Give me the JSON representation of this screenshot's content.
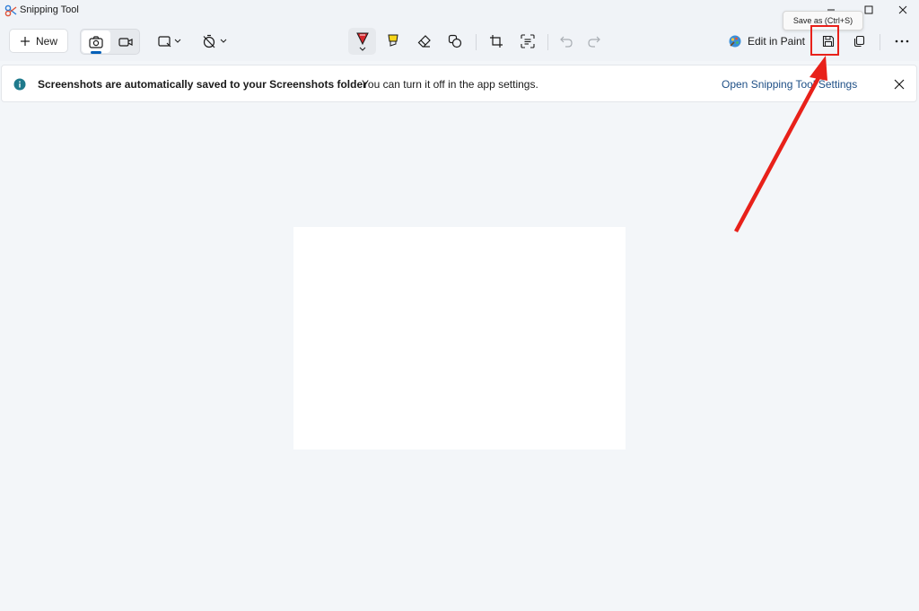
{
  "window": {
    "title": "Snipping Tool"
  },
  "toolbar": {
    "new_label": "New",
    "edit_in_paint_label": "Edit in Paint",
    "icons": {
      "mode_photo": "camera-icon",
      "mode_video": "video-icon",
      "snip_shape": "rectangle-snip-icon",
      "delay": "timer-off-icon",
      "pen": "ballpoint-pen-icon",
      "highlighter": "highlighter-icon",
      "eraser": "eraser-icon",
      "shapes": "shapes-icon",
      "crop": "crop-icon",
      "text_actions": "text-actions-icon",
      "undo": "undo-icon",
      "redo": "redo-icon",
      "save": "save-icon",
      "copy": "copy-icon",
      "more": "more-icon"
    }
  },
  "tooltip": {
    "text": "Save as (Ctrl+S)"
  },
  "infobar": {
    "title": "Screenshots are automatically saved to your Screenshots folder",
    "message": "You can turn it off in the app settings.",
    "link": "Open Snipping Tool Settings"
  },
  "colors": {
    "accent": "#005fb8",
    "annotation_red": "#e8211a",
    "info_icon": "#1f7a8c",
    "link": "#1e4f86"
  }
}
